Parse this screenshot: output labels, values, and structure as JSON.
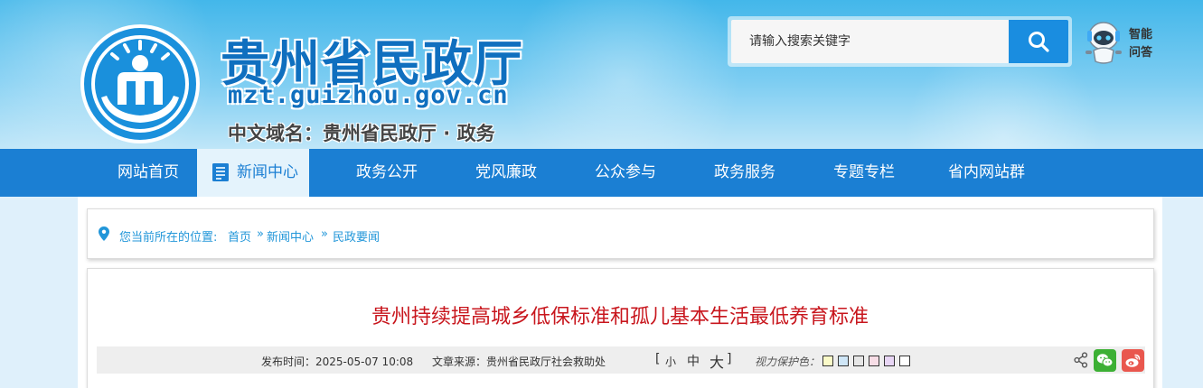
{
  "header": {
    "site_title": "贵州省民政厅",
    "site_domain": "mzt.guizhou.gov.cn",
    "cn_domain": "中文域名：贵州省民政厅 · 政务",
    "search_placeholder": "请输入搜索关键字",
    "qa_line1": "智能",
    "qa_line2": "问答"
  },
  "nav": {
    "items": [
      {
        "label": "网站首页"
      },
      {
        "label": "新闻中心"
      },
      {
        "label": "政务公开"
      },
      {
        "label": "党风廉政"
      },
      {
        "label": "公众参与"
      },
      {
        "label": "政务服务"
      },
      {
        "label": "专题专栏"
      },
      {
        "label": "省内网站群"
      }
    ],
    "active_index": 1
  },
  "breadcrumb": {
    "prefix": "您当前所在的位置:",
    "items": [
      "首页",
      "新闻中心",
      "民政要闻"
    ],
    "separator": "»"
  },
  "article": {
    "title": "贵州持续提高城乡低保标准和孤儿基本生活最低养育标准",
    "publish_time": "发布时间：2025-05-07 10:08",
    "source": "文章来源：贵州省民政厅社会救助处",
    "font_size_open": "[",
    "font_size_small": "小",
    "font_size_medium": "中",
    "font_size_large": "大",
    "font_size_close": "]",
    "eye_protection_label": "视力保护色：",
    "eye_colors": [
      "#fafac8",
      "#cfe6f7",
      "#e6e6e6",
      "#f7dde6",
      "#e8d6f5",
      "#ffffff"
    ]
  },
  "colors": {
    "brand_blue": "#1b7fd3",
    "title_red": "#c8161d",
    "link_blue": "#2196d9",
    "wechat_green": "#3cb034",
    "weibo_red": "#e9574e"
  }
}
